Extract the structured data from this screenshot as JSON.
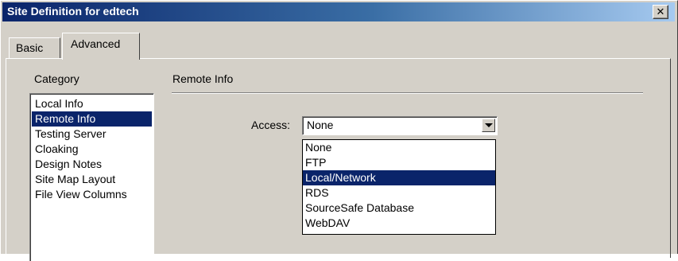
{
  "window": {
    "title": "Site Definition for edtech",
    "close_glyph": "✕"
  },
  "tabs": [
    {
      "label": "Basic",
      "active": false
    },
    {
      "label": "Advanced",
      "active": true
    }
  ],
  "category": {
    "label": "Category",
    "items": [
      "Local Info",
      "Remote Info",
      "Testing Server",
      "Cloaking",
      "Design Notes",
      "Site Map Layout",
      "File View Columns"
    ],
    "selected": "Remote Info"
  },
  "section": {
    "title": "Remote Info"
  },
  "access": {
    "label": "Access:",
    "value": "None",
    "options": [
      "None",
      "FTP",
      "Local/Network",
      "RDS",
      "SourceSafe Database",
      "WebDAV"
    ],
    "highlighted": "Local/Network"
  },
  "icons": {
    "close": "close-icon",
    "dropdown": "chevron-down-icon"
  },
  "colors": {
    "selection": "#0a246a",
    "titlebar_start": "#0a246a",
    "titlebar_end": "#a6caf0",
    "face": "#d4d0c8"
  }
}
